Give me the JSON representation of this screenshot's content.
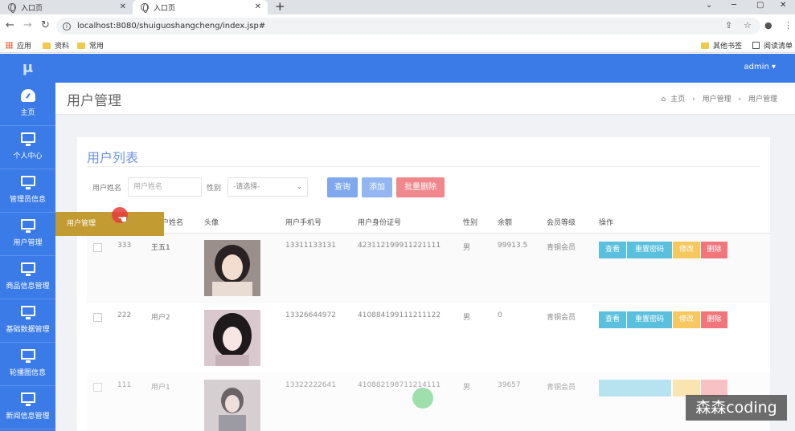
{
  "browser": {
    "tabs": [
      {
        "label": "入口页"
      },
      {
        "label": "入口页"
      }
    ],
    "url": "localhost:8080/shuiguoshangcheng/index.jsp#",
    "bookmarks": [
      "应用",
      "资料",
      "常用"
    ],
    "bookmarks_right": [
      "其他书签",
      "阅读清单"
    ]
  },
  "app": {
    "logo": "μ",
    "user_menu": "admin ▾",
    "sidebar": [
      {
        "label": "主页",
        "icon": "dashboard-icon"
      },
      {
        "label": "个人中心",
        "icon": "monitor-icon"
      },
      {
        "label": "管理员信息",
        "icon": "monitor-icon"
      },
      {
        "label": "用户管理",
        "icon": "monitor-icon"
      },
      {
        "label": "商品信息管理",
        "icon": "monitor-icon"
      },
      {
        "label": "基础数据管理",
        "icon": "monitor-icon"
      },
      {
        "label": "轮播图信息",
        "icon": "monitor-icon"
      },
      {
        "label": "新闻信息管理",
        "icon": "monitor-icon"
      }
    ],
    "flyout": "用户管理",
    "page_title": "用户管理",
    "breadcrumb": [
      "主页",
      "用户管理",
      "用户管理"
    ],
    "card_title": "用户列表",
    "filters": {
      "name_label": "用户姓名",
      "name_placeholder": "用户姓名",
      "gender_label": "性别",
      "gender_value": "-请选择-"
    },
    "buttons": {
      "search": "查询",
      "add": "添加",
      "batch_delete": "批量删除"
    },
    "columns": [
      "户姓名",
      "头像",
      "用户手机号",
      "用户身份证号",
      "性别",
      "余额",
      "会员等级",
      "操作"
    ],
    "rows": [
      {
        "id": "333",
        "name": "王五1",
        "phone": "13311133131",
        "idcard": "423112199911221111",
        "gender": "男",
        "balance": "99913.5",
        "level": "青铜会员"
      },
      {
        "id": "222",
        "name": "用户2",
        "phone": "13326644972",
        "idcard": "410884199111211122",
        "gender": "男",
        "balance": "0",
        "level": "青铜会员"
      },
      {
        "id": "111",
        "name": "用户1",
        "phone": "13322222641",
        "idcard": "410882198711214111",
        "gender": "男",
        "balance": "39657",
        "level": "青铜会员"
      }
    ],
    "row_actions": {
      "view": "查看",
      "reset": "重置密码",
      "edit": "修改",
      "delete": "删除"
    }
  },
  "watermark": "森森coding",
  "colors": {
    "primary": "#3b7be8",
    "flyout": "#c29b32",
    "btn_info": "#5bc0de",
    "btn_warn": "#f6c85f",
    "btn_danger": "#f0767c"
  }
}
